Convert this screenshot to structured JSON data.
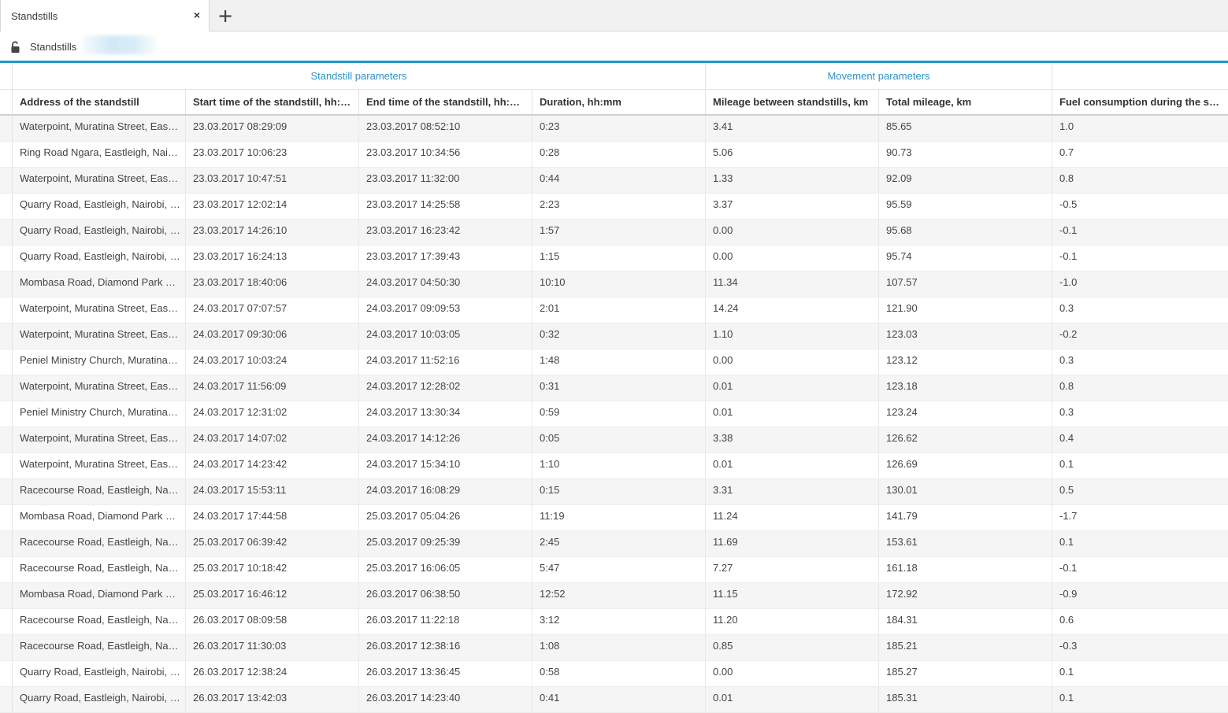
{
  "tab": {
    "label": "Standstills",
    "close_glyph": "×",
    "add_glyph": "+"
  },
  "subbar": {
    "title": "Standstills"
  },
  "accent_color": "#2196c9",
  "groups": [
    {
      "label": "Standstill parameters"
    },
    {
      "label": "Movement parameters"
    },
    {
      "label": ""
    }
  ],
  "columns": [
    "Address of the standstill",
    "Start time of the standstill, hh:m...",
    "End time of the standstill, hh:mm...",
    "Duration, hh:mm",
    "Mileage between standstills, km",
    "Total mileage, km",
    "Fuel consumption during the stan..."
  ],
  "rows": [
    [
      "Waterpoint, Muratina Street, Eastl...",
      "23.03.2017 08:29:09",
      "23.03.2017 08:52:10",
      "0:23",
      "3.41",
      "85.65",
      "1.0"
    ],
    [
      "Ring Road Ngara, Eastleigh, Nairo...",
      "23.03.2017 10:06:23",
      "23.03.2017 10:34:56",
      "0:28",
      "5.06",
      "90.73",
      "0.7"
    ],
    [
      "Waterpoint, Muratina Street, Eastl...",
      "23.03.2017 10:47:51",
      "23.03.2017 11:32:00",
      "0:44",
      "1.33",
      "92.09",
      "0.8"
    ],
    [
      "Quarry Road, Eastleigh, Nairobi, 00...",
      "23.03.2017 12:02:14",
      "23.03.2017 14:25:58",
      "2:23",
      "3.37",
      "95.59",
      "-0.5"
    ],
    [
      "Quarry Road, Eastleigh, Nairobi, 00...",
      "23.03.2017 14:26:10",
      "23.03.2017 16:23:42",
      "1:57",
      "0.00",
      "95.68",
      "-0.1"
    ],
    [
      "Quarry Road, Eastleigh, Nairobi, 00...",
      "23.03.2017 16:24:13",
      "23.03.2017 17:39:43",
      "1:15",
      "0.00",
      "95.74",
      "-0.1"
    ],
    [
      "Mombasa Road, Diamond Park Es...",
      "23.03.2017 18:40:06",
      "24.03.2017 04:50:30",
      "10:10",
      "11.34",
      "107.57",
      "-1.0"
    ],
    [
      "Waterpoint, Muratina Street, Eastl...",
      "24.03.2017 07:07:57",
      "24.03.2017 09:09:53",
      "2:01",
      "14.24",
      "121.90",
      "0.3"
    ],
    [
      "Waterpoint, Muratina Street, Eastl...",
      "24.03.2017 09:30:06",
      "24.03.2017 10:03:05",
      "0:32",
      "1.10",
      "123.03",
      "-0.2"
    ],
    [
      "Peniel Ministry Church, Muratina S...",
      "24.03.2017 10:03:24",
      "24.03.2017 11:52:16",
      "1:48",
      "0.00",
      "123.12",
      "0.3"
    ],
    [
      "Waterpoint, Muratina Street, Eastl...",
      "24.03.2017 11:56:09",
      "24.03.2017 12:28:02",
      "0:31",
      "0.01",
      "123.18",
      "0.8"
    ],
    [
      "Peniel Ministry Church, Muratina S...",
      "24.03.2017 12:31:02",
      "24.03.2017 13:30:34",
      "0:59",
      "0.01",
      "123.24",
      "0.3"
    ],
    [
      "Waterpoint, Muratina Street, Eastl...",
      "24.03.2017 14:07:02",
      "24.03.2017 14:12:26",
      "0:05",
      "3.38",
      "126.62",
      "0.4"
    ],
    [
      "Waterpoint, Muratina Street, Eastl...",
      "24.03.2017 14:23:42",
      "24.03.2017 15:34:10",
      "1:10",
      "0.01",
      "126.69",
      "0.1"
    ],
    [
      "Racecourse Road, Eastleigh, Nairo...",
      "24.03.2017 15:53:11",
      "24.03.2017 16:08:29",
      "0:15",
      "3.31",
      "130.01",
      "0.5"
    ],
    [
      "Mombasa Road, Diamond Park Es...",
      "24.03.2017 17:44:58",
      "25.03.2017 05:04:26",
      "11:19",
      "11.24",
      "141.79",
      "-1.7"
    ],
    [
      "Racecourse Road, Eastleigh, Nairo...",
      "25.03.2017 06:39:42",
      "25.03.2017 09:25:39",
      "2:45",
      "11.69",
      "153.61",
      "0.1"
    ],
    [
      "Racecourse Road, Eastleigh, Nairo...",
      "25.03.2017 10:18:42",
      "25.03.2017 16:06:05",
      "5:47",
      "7.27",
      "161.18",
      "-0.1"
    ],
    [
      "Mombasa Road, Diamond Park Es...",
      "25.03.2017 16:46:12",
      "26.03.2017 06:38:50",
      "12:52",
      "11.15",
      "172.92",
      "-0.9"
    ],
    [
      "Racecourse Road, Eastleigh, Nairo...",
      "26.03.2017 08:09:58",
      "26.03.2017 11:22:18",
      "3:12",
      "11.20",
      "184.31",
      "0.6"
    ],
    [
      "Racecourse Road, Eastleigh, Nairo...",
      "26.03.2017 11:30:03",
      "26.03.2017 12:38:16",
      "1:08",
      "0.85",
      "185.21",
      "-0.3"
    ],
    [
      "Quarry Road, Eastleigh, Nairobi, 00...",
      "26.03.2017 12:38:24",
      "26.03.2017 13:36:45",
      "0:58",
      "0.00",
      "185.27",
      "0.1"
    ],
    [
      "Quarry Road, Eastleigh, Nairobi, 00...",
      "26.03.2017 13:42:03",
      "26.03.2017 14:23:40",
      "0:41",
      "0.01",
      "185.31",
      "0.1"
    ]
  ]
}
